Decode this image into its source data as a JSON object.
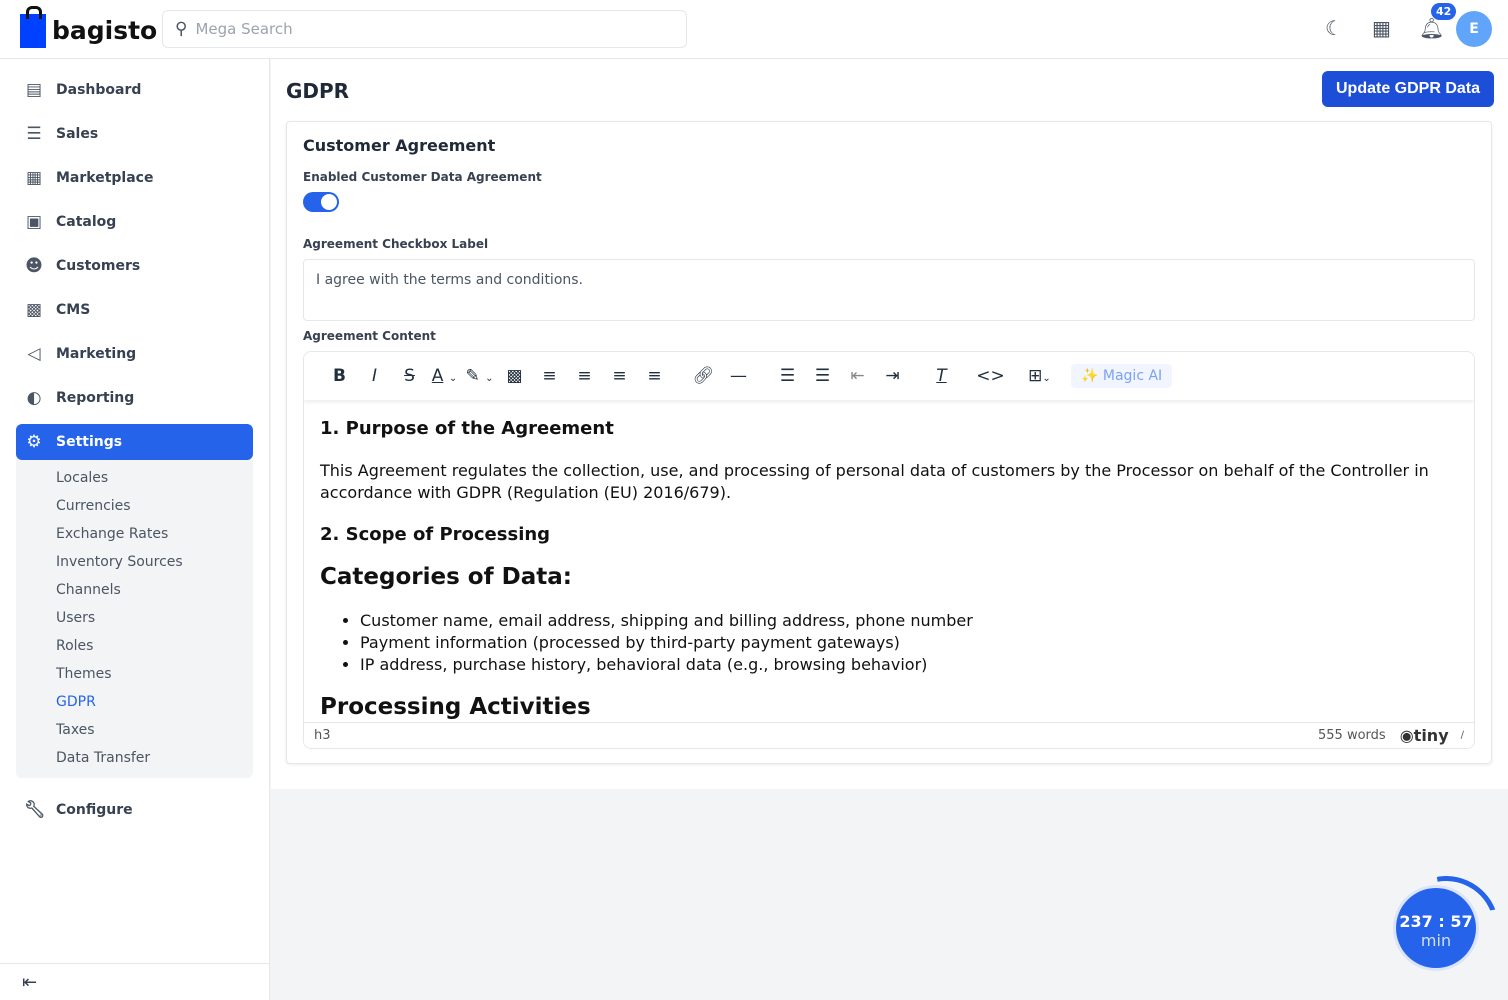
{
  "header": {
    "brand": "bagisto",
    "search_placeholder": "Mega Search",
    "notification_count": "42",
    "avatar_initial": "E"
  },
  "sidebar": {
    "items": [
      {
        "label": "Dashboard",
        "icon": "dashboard-icon"
      },
      {
        "label": "Sales",
        "icon": "sales-icon"
      },
      {
        "label": "Marketplace",
        "icon": "store-icon"
      },
      {
        "label": "Catalog",
        "icon": "catalog-icon"
      },
      {
        "label": "Customers",
        "icon": "user-icon"
      },
      {
        "label": "CMS",
        "icon": "image-icon"
      },
      {
        "label": "Marketing",
        "icon": "megaphone-icon"
      },
      {
        "label": "Reporting",
        "icon": "pie-icon"
      },
      {
        "label": "Settings",
        "icon": "gear-icon"
      }
    ],
    "settings_sub": [
      "Locales",
      "Currencies",
      "Exchange Rates",
      "Inventory Sources",
      "Channels",
      "Users",
      "Roles",
      "Themes",
      "GDPR",
      "Taxes",
      "Data Transfer"
    ],
    "configure": "Configure"
  },
  "page": {
    "title": "GDPR",
    "update_button": "Update GDPR Data"
  },
  "form": {
    "section_title": "Customer Agreement",
    "toggle_label": "Enabled Customer Data Agreement",
    "toggle_on": true,
    "checkbox_label": "Agreement Checkbox Label",
    "checkbox_value": "I agree with the terms and conditions.",
    "content_label": "Agreement Content"
  },
  "editor": {
    "magic_ai": "Magic AI",
    "h1": "1. Purpose of the Agreement",
    "p1": "This Agreement regulates the collection, use, and processing of personal data of customers by the Processor on behalf of the Controller in accordance with GDPR (Regulation (EU) 2016/679).",
    "h2": "2. Scope of Processing",
    "h3": "Categories of Data:",
    "list": [
      "Customer name, email address, shipping and billing address, phone number",
      "Payment information (processed by third-party payment gateways)",
      "IP address, purchase history, behavioral data (e.g., browsing behavior)"
    ],
    "h4": "Processing Activities",
    "path": "h3",
    "word_count": "555 words",
    "brand": "tiny"
  },
  "timer": {
    "time": "237 : 57",
    "unit": "min"
  },
  "accent": "#2563eb"
}
